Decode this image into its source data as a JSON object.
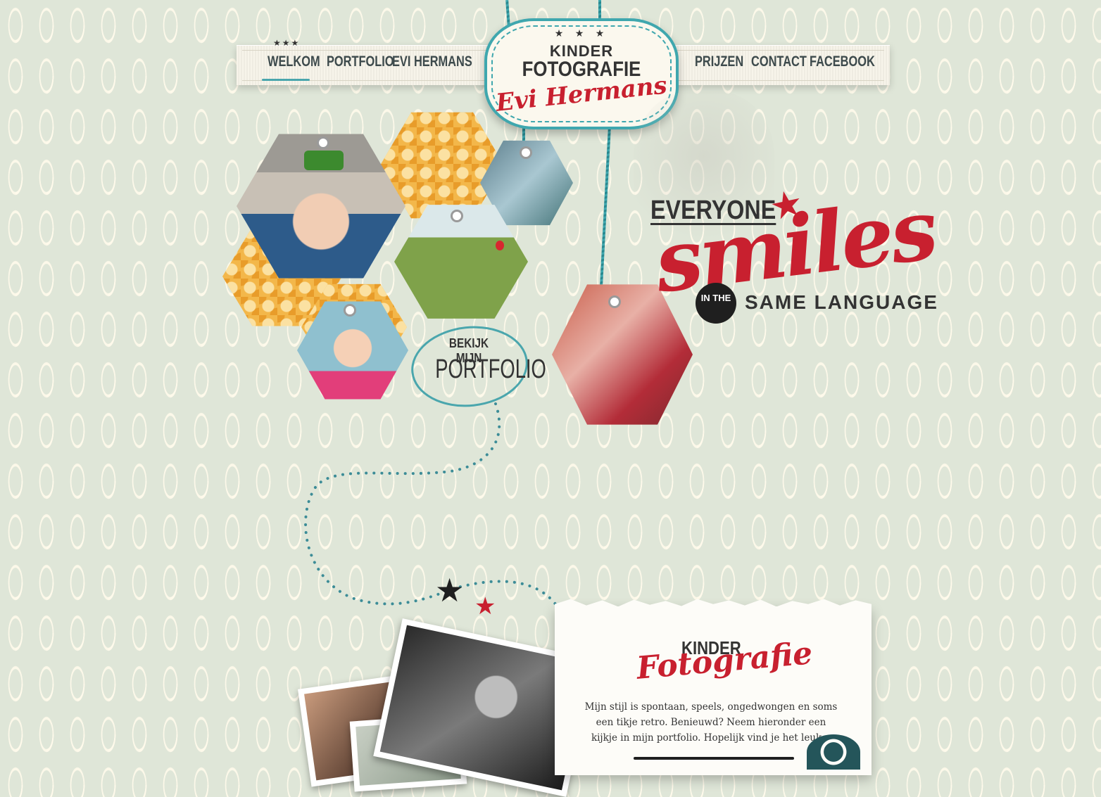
{
  "nav": {
    "items": [
      "WELKOM",
      "PORTFOLIO",
      "EVI HERMANS",
      "PRIJZEN",
      "CONTACT",
      "FACEBOOK"
    ],
    "active": "WELKOM"
  },
  "logo": {
    "stars": "★ ★ ★",
    "line1": "KINDER",
    "line2": "FOTOGRAFIE",
    "line3": "Evi Hermans"
  },
  "hero": {
    "everyone": "EVERYONE",
    "smiles": "smiles",
    "in_the": "IN THE",
    "same_language": "SAME LANGUAGE"
  },
  "cta": {
    "small": "BEKIJK MIJN",
    "big": "PORTFOLIO"
  },
  "intro": {
    "title_top": "KINDER",
    "title_script": "Fotografie",
    "text": "Mijn stijl is spontaan, speels, ongedwongen en soms een tikje retro. Benieuwd? Neem hieronder een kijkje in mijn portfolio. Hopelijk vind je het leuk..."
  },
  "colors": {
    "accent": "#3fa7ae",
    "brand_red": "#c8202f",
    "text_dark": "#333333"
  },
  "icons": [
    "star-icon",
    "star-icon-red"
  ]
}
